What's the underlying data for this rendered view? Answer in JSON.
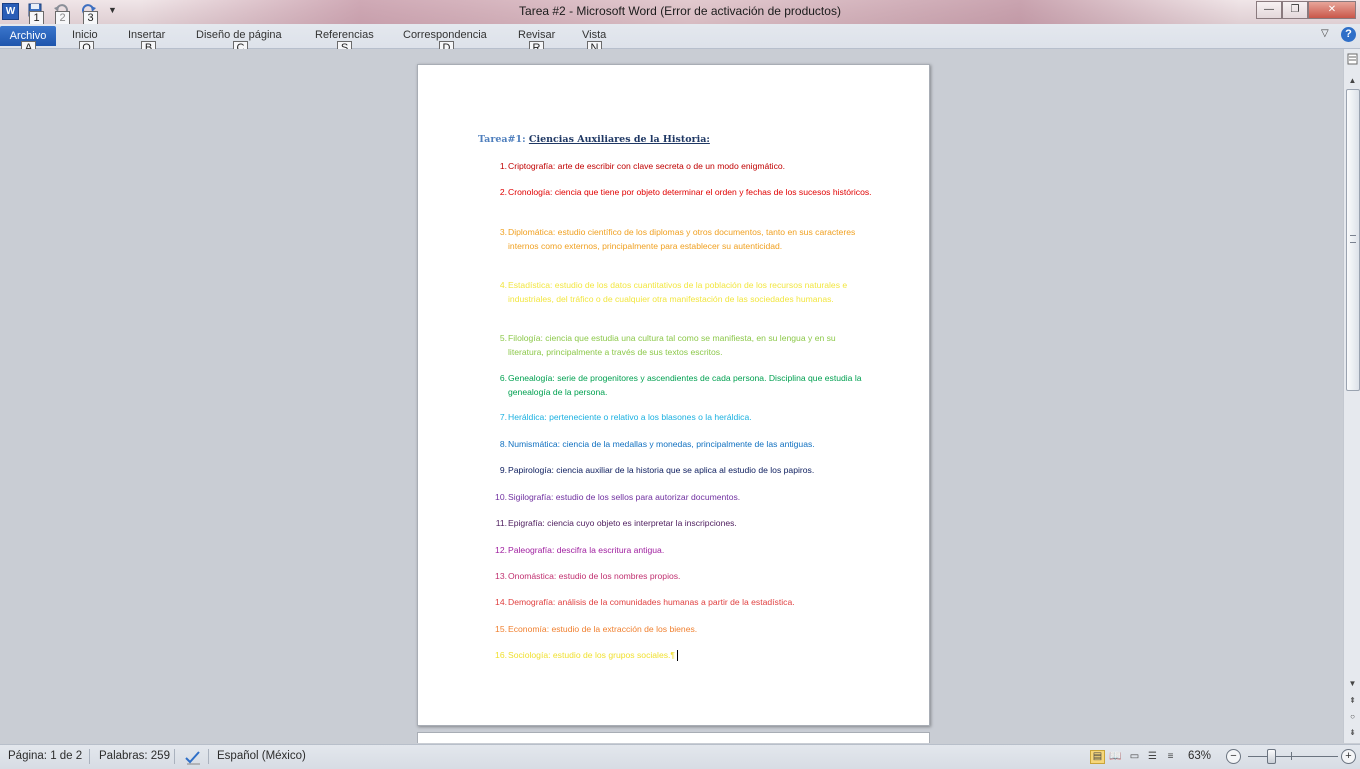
{
  "window": {
    "title": "Tarea #2  -  Microsoft Word (Error de activación de productos)",
    "logo": "W",
    "controls": {
      "minimize": "—",
      "restore": "❐",
      "close": "✕"
    }
  },
  "quick_access": {
    "keytips": [
      "1",
      "2",
      "3"
    ],
    "icons": [
      "save-icon",
      "undo-icon",
      "redo-icon",
      "customize-dropdown-icon"
    ]
  },
  "ribbon": {
    "tabs": [
      {
        "label": "Archivo",
        "keytip": "A"
      },
      {
        "label": "Inicio",
        "keytip": "O"
      },
      {
        "label": "Insertar",
        "keytip": "B"
      },
      {
        "label": "Diseño de página",
        "keytip": "C"
      },
      {
        "label": "Referencias",
        "keytip": "S"
      },
      {
        "label": "Correspondencia",
        "keytip": "D"
      },
      {
        "label": "Revisar",
        "keytip": "R"
      },
      {
        "label": "Vista",
        "keytip": "N"
      }
    ],
    "help": "?"
  },
  "document": {
    "heading_prefix": "Tarea#1: ",
    "heading": "Ciencias Auxiliares de la Historia:",
    "items": [
      {
        "num": "1.",
        "text": "Criptografía: arte de escribir con clave secreta o de un modo enigmático.",
        "color": "#c00000"
      },
      {
        "num": "2.",
        "text": "Cronología: ciencia que tiene por objeto determinar el orden y fechas de los sucesos históricos.",
        "color": "#e00000"
      },
      {
        "num": "3.",
        "text": "Diplomática: estudio científico de los diplomas y otros documentos, tanto en sus caracteres internos como externos, principalmente para establecer su autenticidad.",
        "color": "#f0a020"
      },
      {
        "num": "4.",
        "text": "Estadística: estudio de los datos cuantitativos de la población de los recursos naturales e industriales, del tráfico o de cualquier otra manifestación de las sociedades humanas.",
        "color": "#f2e640"
      },
      {
        "num": "5.",
        "text": "Filología: ciencia que estudia una cultura tal como se manifiesta, en su lengua y en su literatura, principalmente a través de sus textos escritos.",
        "color": "#8cc84a"
      },
      {
        "num": "6.",
        "text": "Genealogía: serie de progenitores y ascendientes de cada persona. Disciplina que estudia la genealogía de la persona.",
        "color": "#00a050"
      },
      {
        "num": "7.",
        "text": "Heráldica: perteneciente o relativo a los blasones o la heráldica.",
        "color": "#1ab0e0"
      },
      {
        "num": "8.",
        "text": "Numismática: ciencia de la medallas y monedas, principalmente de las antiguas.",
        "color": "#1070c0"
      },
      {
        "num": "9.",
        "text": "Papirología: ciencia auxiliar de la historia que se aplica al estudio de los papiros.",
        "color": "#102060"
      },
      {
        "num": "10.",
        "text": "Sigilografía: estudio de los sellos para autorizar documentos.",
        "color": "#7030a0"
      },
      {
        "num": "11.",
        "text": "Epigrafía: ciencia cuyo objeto es interpretar la inscripciones.",
        "color": "#502060"
      },
      {
        "num": "12.",
        "text": "Paleografía: descifra la escritura antigua.",
        "color": "#a020a0"
      },
      {
        "num": "13.",
        "text": "Onomástica: estudio de los nombres propios.",
        "color": "#c03070"
      },
      {
        "num": "14.",
        "text": "Demografía: análisis de la comunidades humanas a partir de la estadística.",
        "color": "#e04040"
      },
      {
        "num": "15.",
        "text": "Economía: estudio de la extracción de los bienes.",
        "color": "#f08030"
      },
      {
        "num": "16.",
        "text": "Sociología: estudio de los grupos sociales.¶",
        "color": "#f0e030"
      }
    ]
  },
  "statusbar": {
    "page": "Página: 1 de 2",
    "words": "Palabras: 259",
    "language": "Español (México)",
    "zoom": "63%",
    "zoom_value_percent": 63,
    "zoom_minus": "−",
    "zoom_plus": "+",
    "views": [
      "print-layout-icon",
      "full-screen-reading-icon",
      "web-layout-icon",
      "outline-icon",
      "draft-icon"
    ]
  }
}
